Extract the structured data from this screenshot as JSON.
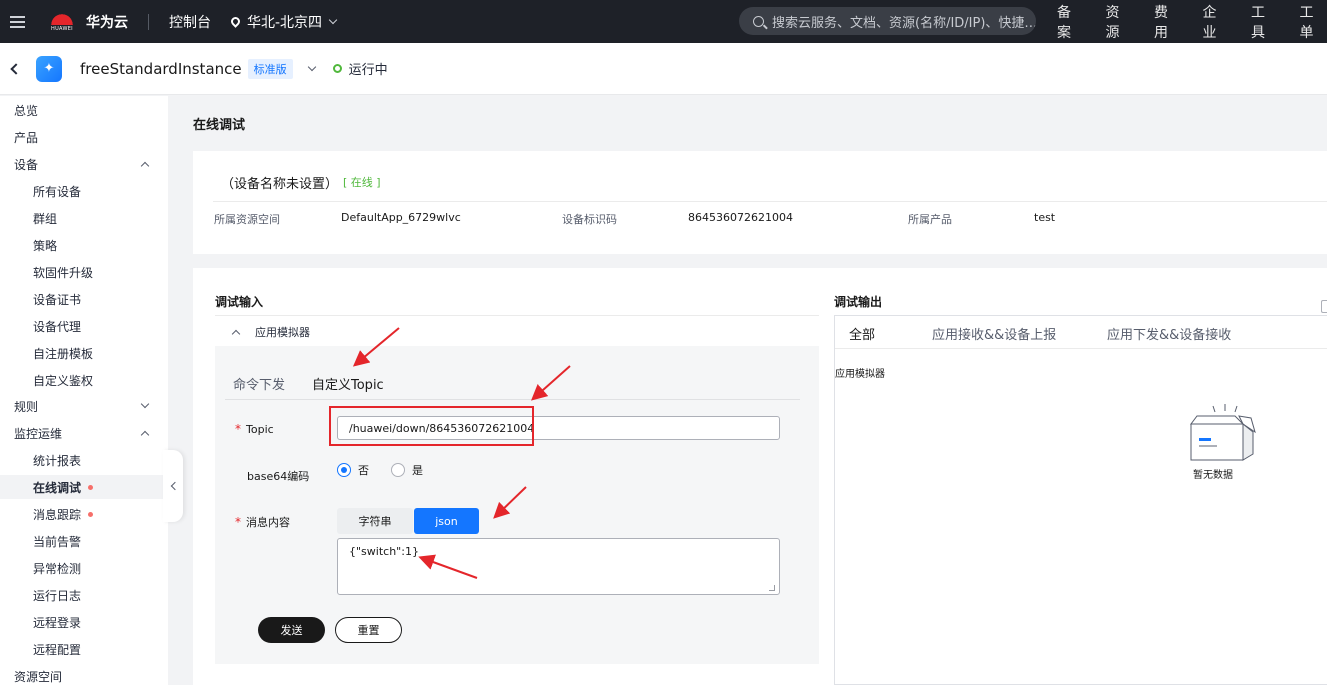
{
  "topbar": {
    "brand": "华为云",
    "logo_text": "HUAWEI",
    "console": "控制台",
    "region": "华北-北京四",
    "search_placeholder": "搜索云服务、文档、资源(名称/ID/IP)、快捷…",
    "nav": [
      "备案",
      "资源",
      "费用",
      "企业",
      "工具",
      "工单"
    ]
  },
  "subheader": {
    "instance_name": "freeStandardInstance",
    "edition": "标准版",
    "status": "运行中"
  },
  "sidebar": {
    "items": [
      {
        "label": "总览",
        "level": 1
      },
      {
        "label": "产品",
        "level": 1
      },
      {
        "label": "设备",
        "level": 1,
        "chevron": "up"
      },
      {
        "label": "所有设备",
        "level": 2
      },
      {
        "label": "群组",
        "level": 2
      },
      {
        "label": "策略",
        "level": 2
      },
      {
        "label": "软固件升级",
        "level": 2
      },
      {
        "label": "设备证书",
        "level": 2
      },
      {
        "label": "设备代理",
        "level": 2
      },
      {
        "label": "自注册模板",
        "level": 2
      },
      {
        "label": "自定义鉴权",
        "level": 2
      },
      {
        "label": "规则",
        "level": 1,
        "chevron": "down"
      },
      {
        "label": "监控运维",
        "level": 1,
        "chevron": "up"
      },
      {
        "label": "统计报表",
        "level": 2
      },
      {
        "label": "在线调试",
        "level": 2,
        "active": true,
        "dot": true
      },
      {
        "label": "消息跟踪",
        "level": 2,
        "dot": true
      },
      {
        "label": "当前告警",
        "level": 2
      },
      {
        "label": "异常检测",
        "level": 2
      },
      {
        "label": "运行日志",
        "level": 2
      },
      {
        "label": "远程登录",
        "level": 2
      },
      {
        "label": "远程配置",
        "level": 2
      },
      {
        "label": "资源空间",
        "level": 1
      }
    ]
  },
  "main": {
    "page_title": "在线调试",
    "device": {
      "name": "（设备名称未设置）",
      "status": "[ 在线 ]",
      "space_label": "所属资源空间",
      "space_value": "DefaultApp_6729wlvc",
      "id_label": "设备标识码",
      "id_value": "864536072621004",
      "product_label": "所属产品",
      "product_value": "test"
    },
    "debug_input": {
      "title": "调试输入",
      "simulator": "应用模拟器",
      "tabs": [
        "命令下发",
        "自定义Topic"
      ],
      "selected_tab": "自定义Topic",
      "topic_label": "Topic",
      "topic_value": "/huawei/down/864536072621004",
      "base64_label": "base64编码",
      "radio_no": "否",
      "radio_yes": "是",
      "content_label": "消息内容",
      "format_string": "字符串",
      "format_json": "json",
      "content_value": "{\"switch\":1}",
      "send": "发送",
      "reset": "重置"
    },
    "debug_output": {
      "title": "调试输出",
      "tabs": [
        "全部",
        "应用接收&&设备上报",
        "应用下发&&设备接收"
      ],
      "simulator": "应用模拟器",
      "empty": "暂无数据"
    }
  },
  "colors": {
    "topbar": "#1e2128",
    "primary": "#1476ff",
    "online": "#50b83c",
    "annotation": "#e4262b"
  }
}
